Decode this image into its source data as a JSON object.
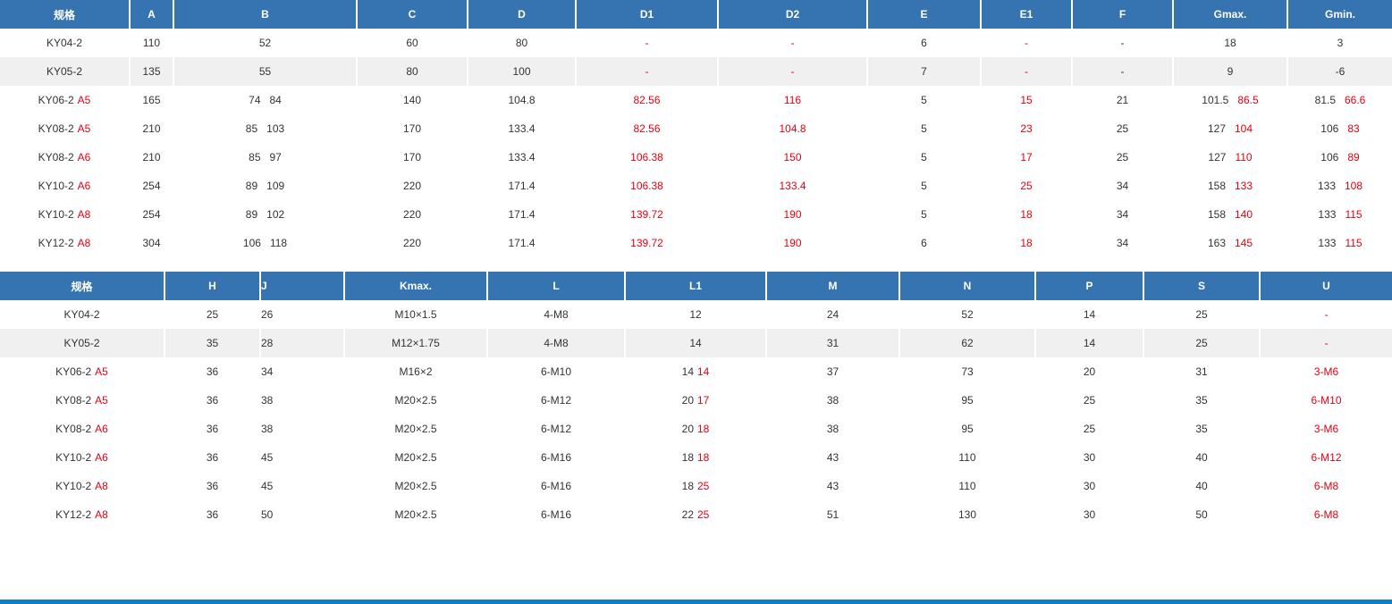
{
  "table1": {
    "headers": [
      "规格",
      "A",
      "B",
      "C",
      "D",
      "D1",
      "D2",
      "E",
      "E1",
      "F",
      "Gmax.",
      "Gmin."
    ],
    "rows": [
      {
        "model": "KY04-2",
        "variant": "",
        "A": "110",
        "B1": "52",
        "B2": "",
        "C": "60",
        "D": "80",
        "D1": "-",
        "D2": "-",
        "E": "6",
        "E1": "-",
        "F": "-",
        "Gmax1": "18",
        "Gmax2": "",
        "Gmin1": "3",
        "Gmin2": ""
      },
      {
        "model": "KY05-2",
        "variant": "",
        "A": "135",
        "B1": "55",
        "B2": "",
        "C": "80",
        "D": "100",
        "D1": "-",
        "D2": "-",
        "E": "7",
        "E1": "-",
        "F": "-",
        "Gmax1": "9",
        "Gmax2": "",
        "Gmin1": "-6",
        "Gmin2": ""
      },
      {
        "model": "KY06-2",
        "variant": "A5",
        "A": "165",
        "B1": "74",
        "B2": "84",
        "C": "140",
        "D": "104.8",
        "D1": "82.56",
        "D2": "116",
        "E": "5",
        "E1": "15",
        "F": "21",
        "Gmax1": "101.5",
        "Gmax2": "86.5",
        "Gmin1": "81.5",
        "Gmin2": "66.6"
      },
      {
        "model": "KY08-2",
        "variant": "A5",
        "A": "210",
        "B1": "85",
        "B2": "103",
        "C": "170",
        "D": "133.4",
        "D1": "82.56",
        "D2": "104.8",
        "E": "5",
        "E1": "23",
        "F": "25",
        "Gmax1": "127",
        "Gmax2": "104",
        "Gmin1": "106",
        "Gmin2": "83"
      },
      {
        "model": "KY08-2",
        "variant": "A6",
        "A": "210",
        "B1": "85",
        "B2": "97",
        "C": "170",
        "D": "133.4",
        "D1": "106.38",
        "D2": "150",
        "E": "5",
        "E1": "17",
        "F": "25",
        "Gmax1": "127",
        "Gmax2": "110",
        "Gmin1": "106",
        "Gmin2": "89"
      },
      {
        "model": "KY10-2",
        "variant": "A6",
        "A": "254",
        "B1": "89",
        "B2": "109",
        "C": "220",
        "D": "171.4",
        "D1": "106.38",
        "D2": "133.4",
        "E": "5",
        "E1": "25",
        "F": "34",
        "Gmax1": "158",
        "Gmax2": "133",
        "Gmin1": "133",
        "Gmin2": "108"
      },
      {
        "model": "KY10-2",
        "variant": "A8",
        "A": "254",
        "B1": "89",
        "B2": "102",
        "C": "220",
        "D": "171.4",
        "D1": "139.72",
        "D2": "190",
        "E": "5",
        "E1": "18",
        "F": "34",
        "Gmax1": "158",
        "Gmax2": "140",
        "Gmin1": "133",
        "Gmin2": "115"
      },
      {
        "model": "KY12-2",
        "variant": "A8",
        "A": "304",
        "B1": "106",
        "B2": "118",
        "C": "220",
        "D": "171.4",
        "D1": "139.72",
        "D2": "190",
        "E": "6",
        "E1": "18",
        "F": "34",
        "Gmax1": "163",
        "Gmax2": "145",
        "Gmin1": "133",
        "Gmin2": "115"
      }
    ]
  },
  "table2": {
    "headers": [
      "规格",
      "H",
      "J",
      "Kmax.",
      "L",
      "L1",
      "M",
      "N",
      "P",
      "S",
      "U"
    ],
    "rows": [
      {
        "model": "KY04-2",
        "variant": "",
        "H": "25",
        "J": "26",
        "Kmax": "M10×1.5",
        "L": "4-M8",
        "L1a": "12",
        "L1b": "",
        "M": "24",
        "N": "52",
        "P": "14",
        "S": "25",
        "U": "-"
      },
      {
        "model": "KY05-2",
        "variant": "",
        "H": "35",
        "J": "28",
        "Kmax": "M12×1.75",
        "L": "4-M8",
        "L1a": "14",
        "L1b": "",
        "M": "31",
        "N": "62",
        "P": "14",
        "S": "25",
        "U": "-"
      },
      {
        "model": "KY06-2",
        "variant": "A5",
        "H": "36",
        "J": "34",
        "Kmax": "M16×2",
        "L": "6-M10",
        "L1a": "14",
        "L1b": "14",
        "M": "37",
        "N": "73",
        "P": "20",
        "S": "31",
        "U": "3-M6"
      },
      {
        "model": "KY08-2",
        "variant": "A5",
        "H": "36",
        "J": "38",
        "Kmax": "M20×2.5",
        "L": "6-M12",
        "L1a": "20",
        "L1b": "17",
        "M": "38",
        "N": "95",
        "P": "25",
        "S": "35",
        "U": "6-M10"
      },
      {
        "model": "KY08-2",
        "variant": "A6",
        "H": "36",
        "J": "38",
        "Kmax": "M20×2.5",
        "L": "6-M12",
        "L1a": "20",
        "L1b": "18",
        "M": "38",
        "N": "95",
        "P": "25",
        "S": "35",
        "U": "3-M6"
      },
      {
        "model": "KY10-2",
        "variant": "A6",
        "H": "36",
        "J": "45",
        "Kmax": "M20×2.5",
        "L": "6-M16",
        "L1a": "18",
        "L1b": "18",
        "M": "43",
        "N": "110",
        "P": "30",
        "S": "40",
        "U": "6-M12"
      },
      {
        "model": "KY10-2",
        "variant": "A8",
        "H": "36",
        "J": "45",
        "Kmax": "M20×2.5",
        "L": "6-M16",
        "L1a": "18",
        "L1b": "25",
        "M": "43",
        "N": "110",
        "P": "30",
        "S": "40",
        "U": "6-M8"
      },
      {
        "model": "KY12-2",
        "variant": "A8",
        "H": "36",
        "J": "50",
        "Kmax": "M20×2.5",
        "L": "6-M16",
        "L1a": "22",
        "L1b": "25",
        "M": "51",
        "N": "130",
        "P": "30",
        "S": "50",
        "U": "6-M8"
      }
    ]
  },
  "colors": {
    "header_bg": "#3573b1",
    "alt_row_bg": "#f0f0f0",
    "accent_red": "#e60012",
    "bottom_bar": "#0e7fc7"
  }
}
